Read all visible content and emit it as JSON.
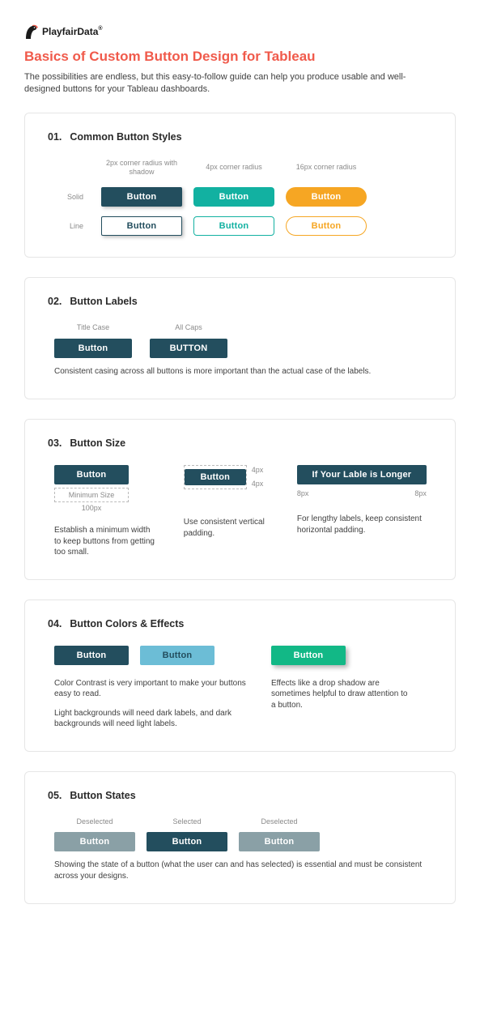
{
  "logo": {
    "text": "PlayfairData",
    "reg": "®"
  },
  "title": "Basics of Custom Button Design for Tableau",
  "intro": "The possibilities are endless, but this easy-to-follow guide can help you produce usable and well-designed buttons for your Tableau dashboards.",
  "btn_generic": "Button",
  "s01": {
    "num": "01.",
    "title": "Common Button Styles",
    "col1": "2px corner radius with shadow",
    "col2": "4px corner radius",
    "col3": "16px corner radius",
    "row1": "Solid",
    "row2": "Line"
  },
  "s02": {
    "num": "02.",
    "title": "Button Labels",
    "c1": "Title Case",
    "c2": "All Caps",
    "b1": "Button",
    "b2": "BUTTON",
    "note": "Consistent casing across all buttons is more important than the actual case of the labels."
  },
  "s03": {
    "num": "03.",
    "title": "Button Size",
    "minsize": "Minimum Size",
    "px100": "100px",
    "px4a": "4px",
    "px4b": "4px",
    "px8a": "8px",
    "px8b": "8px",
    "long": "If Your Lable is Longer",
    "d1": "Establish a minimum width to keep buttons from getting too small.",
    "d2": "Use consistent vertical padding.",
    "d3": "For lengthy labels, keep consistent horizontal padding."
  },
  "s04": {
    "num": "04.",
    "title": "Button Colors & Effects",
    "leftnote1": "Color Contrast is very important to make your buttons easy to read.",
    "leftnote2": "Light backgrounds will need dark labels, and dark backgrounds will need light labels.",
    "rightnote": "Effects like a drop shadow are sometimes helpful to draw attention to a button."
  },
  "s05": {
    "num": "05.",
    "title": "Button States",
    "c1": "Deselected",
    "c2": "Selected",
    "c3": "Deselected",
    "note": "Showing the state of a button (what the user can and has selected) is essential and must be consistent across your designs."
  }
}
